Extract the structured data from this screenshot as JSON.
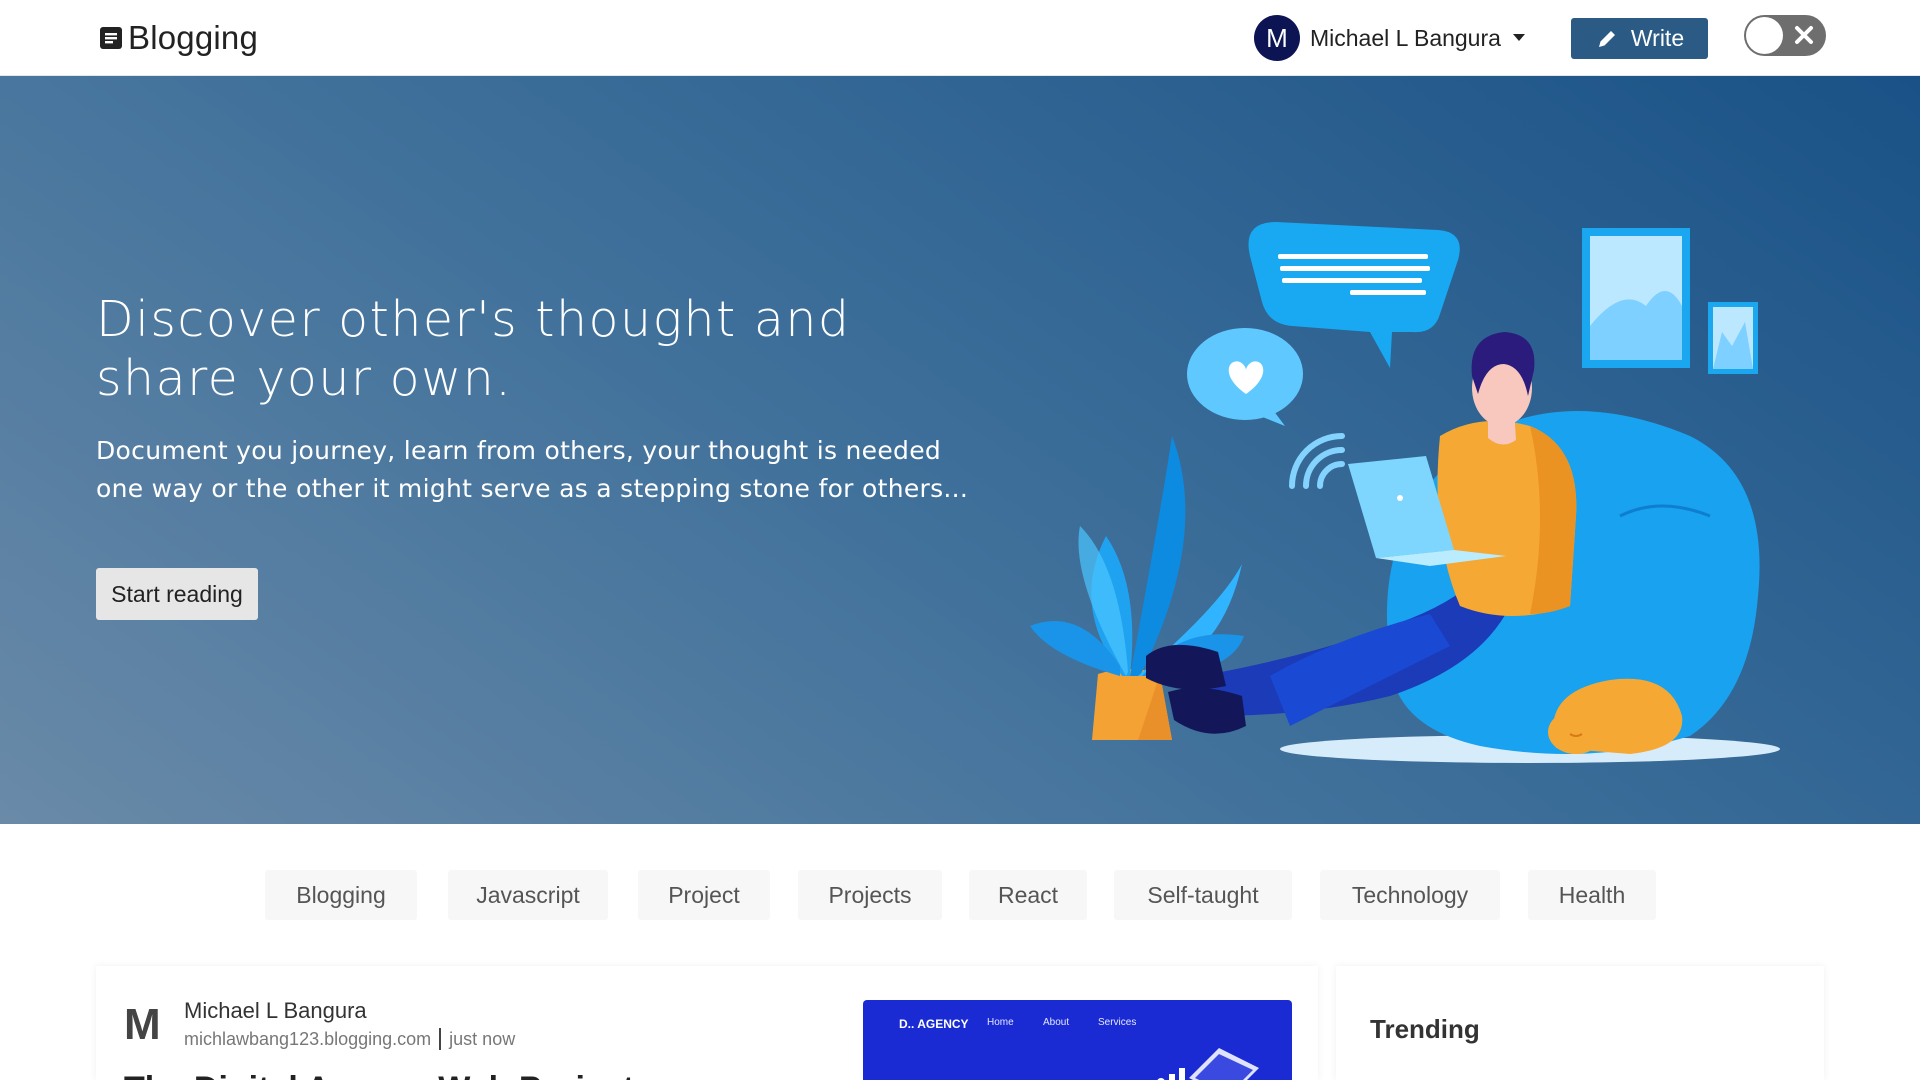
{
  "navbar": {
    "brand": "Blogging",
    "brand_icon": "document-icon",
    "user": {
      "initial": "M",
      "name": "Michael L Bangura",
      "caret_icon": "caret-down-icon"
    },
    "write_label": "Write",
    "write_icon": "pencil-icon",
    "theme_toggle_icon": "close-icon"
  },
  "hero": {
    "title": "Discover other's thought and share your own.",
    "subtitle": "Document you journey, learn from others, your thought is needed one way or the other it might serve as a stepping stone for others...",
    "cta_label": "Start reading",
    "illustration": "person-reading-on-beanbag-illustration"
  },
  "tags": [
    "Blogging",
    "Javascript",
    "Project",
    "Projects",
    "React",
    "Self-taught",
    "Technology",
    "Health"
  ],
  "post": {
    "author_initial": "M",
    "author_name": "Michael L Bangura",
    "author_handle": "michlawbang123.blogging.com",
    "time": "just now",
    "title": "The Digital Agency Web Project",
    "thumbnail": {
      "logo": "D.. AGENCY",
      "nav": [
        "Home",
        "About",
        "Services"
      ]
    }
  },
  "trending": {
    "title": "Trending"
  },
  "colors": {
    "primary": "#2b5b85",
    "avatar_bg": "#0c1454",
    "hero_start": "#6a8aa8",
    "hero_end": "#1a5287"
  }
}
